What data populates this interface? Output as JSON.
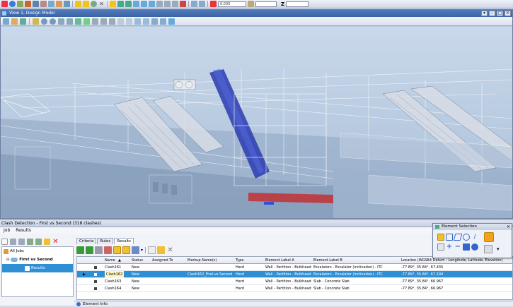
{
  "top_toolbar": {
    "active_value": "0.000",
    "z_label": "Z",
    "icons": [
      "toolbar-icon"
    ]
  },
  "view": {
    "title": "View 1, Design Model"
  },
  "clash": {
    "title": "Clash Detection - First vs Second (318 clashes)",
    "menu": [
      "Job",
      "Results"
    ],
    "tree": {
      "root": "All Jobs",
      "job": "First vs Second",
      "results": "Results"
    },
    "tabs": [
      "Criteria",
      "Rules",
      "Results"
    ],
    "columns": [
      "Name",
      "Status",
      "Assigned To",
      "Markup Name(s)",
      "Type",
      "Element Label A",
      "Element Label B",
      "Location (WGS84 Datum - Longitude, Latitude, Elevation)"
    ],
    "rows": [
      {
        "name": "Clash161",
        "status": "New",
        "assigned": "",
        "markup": "",
        "type": "Hard",
        "label_a": "Wall - Partition - Bulkhead",
        "label_b": "Escalators - Escalator (inclination) - ITC",
        "location": "-77.89°, 35.84°, 67.435"
      },
      {
        "name": "Clash162",
        "status": "New",
        "assigned": "",
        "markup": "Clash162_First vs Second",
        "type": "Hard",
        "label_a": "Wall - Partition - Bulkhead",
        "label_b": "Escalators - Escalator (inclination) - ITC",
        "location": "-77.89°, 35.84°, 67.194"
      },
      {
        "name": "Clash163",
        "status": "New",
        "assigned": "",
        "markup": "",
        "type": "Hard",
        "label_a": "Wall - Partition - Bulkhead",
        "label_b": "Slab - Concrete Slab",
        "location": "-77.89°, 35.84°, 66.967"
      },
      {
        "name": "Clash164",
        "status": "New",
        "assigned": "",
        "markup": "",
        "type": "Hard",
        "label_a": "Wall - Partition - Bulkhead",
        "label_b": "Slab - Concrete Slab",
        "location": "-77.89°, 35.84°, 66.967"
      }
    ],
    "element_info": "Element Info"
  },
  "element_selection": {
    "title": "Element Selection"
  },
  "colors": {
    "accent": "#2f8fd5",
    "sky": "#b8cbe0",
    "escalator": "#2a3bb0"
  }
}
